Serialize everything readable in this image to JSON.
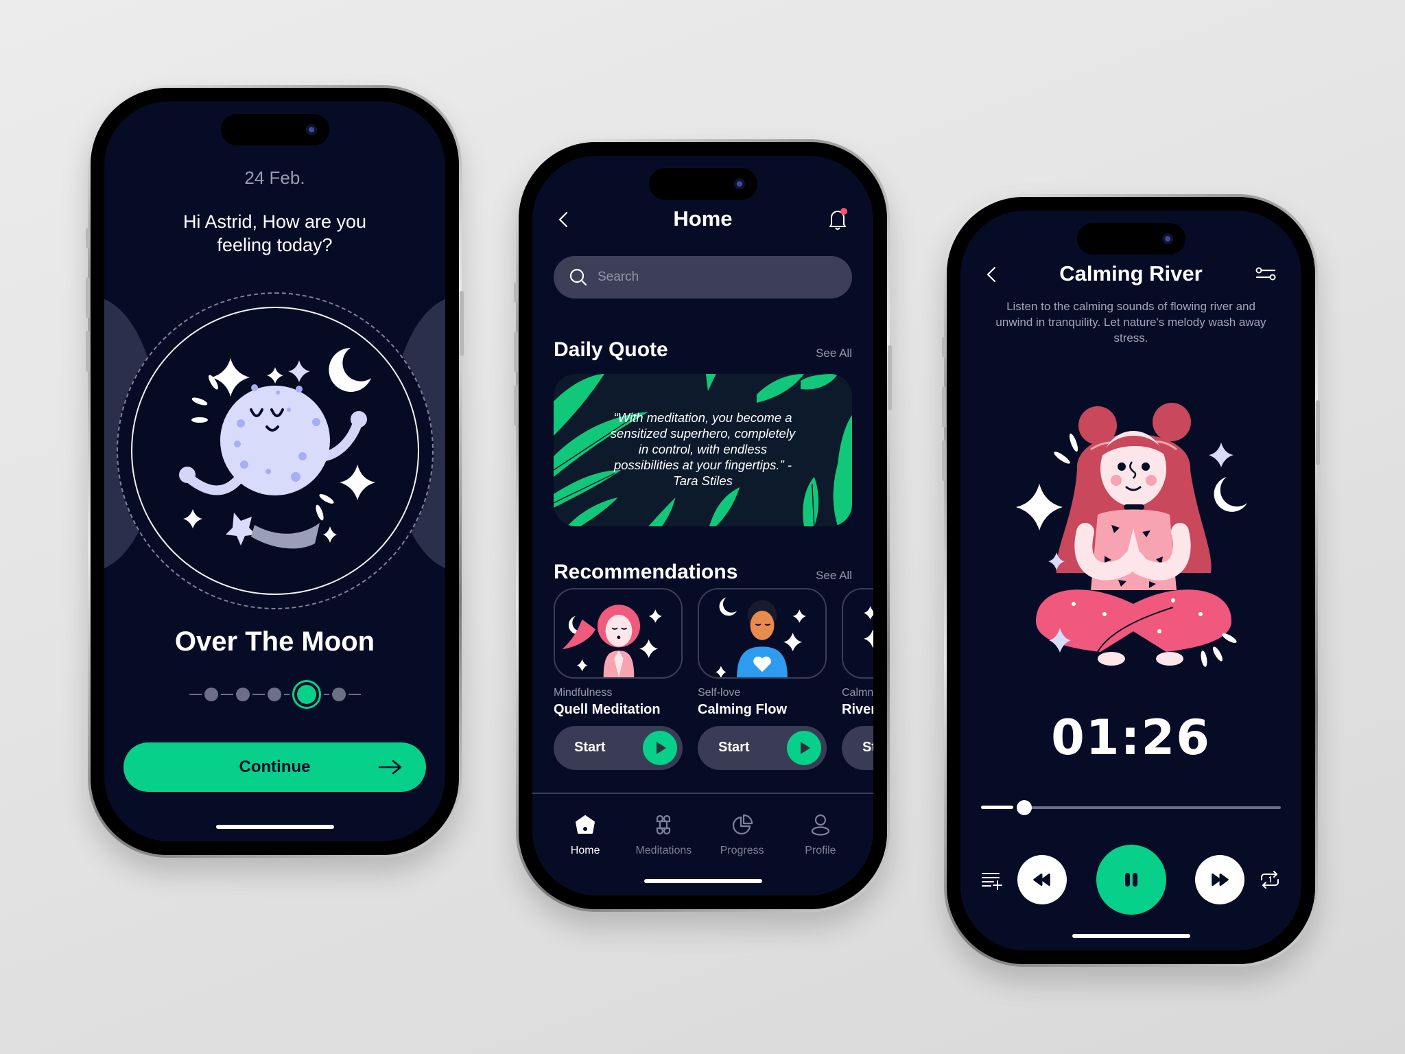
{
  "theme": {
    "background": "#070c26",
    "accent": "#06d08a",
    "muted_text": "#9597a8",
    "surface": "#3c3f57"
  },
  "mood_screen": {
    "date": "24 Feb.",
    "greeting_line1": "Hi Astrid, How are you",
    "greeting_line2": "feeling today?",
    "mood_label": "Over The Moon",
    "mood_steps": {
      "total": 5,
      "selected_index": 4
    },
    "continue_label": "Continue",
    "illustration": "meditating-moon-character"
  },
  "home_screen": {
    "title": "Home",
    "back_icon": "chevron-left-icon",
    "notification_icon": "bell-icon",
    "notification_badge": true,
    "search": {
      "placeholder": "Search",
      "value": ""
    },
    "daily_quote": {
      "heading": "Daily Quote",
      "see_all": "See All",
      "quote": "“With meditation, you become a sensitized superhero, completely in control, with endless possibilities at your fingertips.” - Tara Stiles"
    },
    "recommendations": {
      "heading": "Recommendations",
      "see_all": "See All",
      "items": [
        {
          "category": "Mindfulness",
          "title": "Quell Meditation",
          "button": "Start",
          "illustration": "pink-haired-woman-meditating"
        },
        {
          "category": "Self-love",
          "title": "Calming Flow",
          "button": "Start",
          "illustration": "man-blue-heart-shirt-meditating"
        },
        {
          "category": "Calmness",
          "title": "River",
          "button": "Start",
          "illustration": "stars-partial"
        }
      ]
    },
    "tabbar": [
      {
        "label": "Home",
        "icon": "home-icon",
        "active": true
      },
      {
        "label": "Meditations",
        "icon": "command-icon",
        "active": false
      },
      {
        "label": "Progress",
        "icon": "pie-chart-icon",
        "active": false
      },
      {
        "label": "Profile",
        "icon": "user-icon",
        "active": false
      }
    ]
  },
  "player_screen": {
    "title": "Calming River",
    "back_icon": "chevron-left-icon",
    "settings_icon": "sliders-icon",
    "description": "Listen to the calming sounds of flowing river and unwind in tranquility. Let nature's melody wash away stress.",
    "illustration": "red-haired-girl-meditating",
    "time": "01:26",
    "progress_fraction": 0.12,
    "controls": [
      {
        "name": "add-to-playlist",
        "icon": "playlist-add-icon"
      },
      {
        "name": "rewind",
        "icon": "rewind-icon"
      },
      {
        "name": "pause",
        "icon": "pause-icon"
      },
      {
        "name": "fast-forward",
        "icon": "fast-forward-icon"
      },
      {
        "name": "repeat-one",
        "icon": "repeat-one-icon"
      }
    ]
  }
}
